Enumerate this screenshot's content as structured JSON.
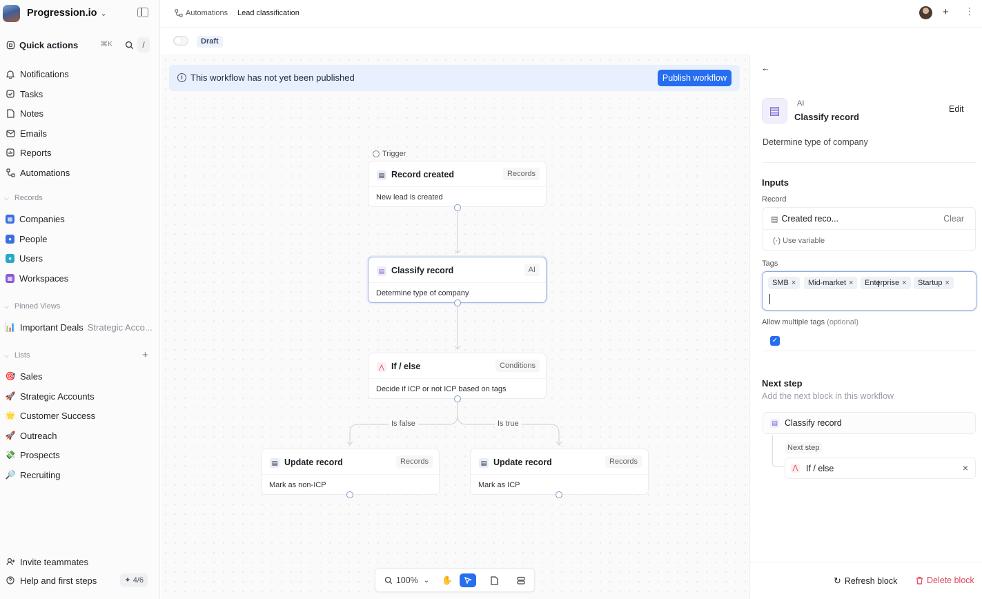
{
  "workspace": {
    "name": "Progression.io"
  },
  "sidebar": {
    "quick_actions": {
      "label": "Quick actions",
      "shortcut": "⌘K",
      "slash": "/"
    },
    "nav": [
      {
        "label": "Notifications",
        "icon": "bell-icon"
      },
      {
        "label": "Tasks",
        "icon": "check-square-icon"
      },
      {
        "label": "Notes",
        "icon": "note-icon"
      },
      {
        "label": "Emails",
        "icon": "mail-icon"
      },
      {
        "label": "Reports",
        "icon": "report-icon"
      },
      {
        "label": "Automations",
        "icon": "automation-icon"
      }
    ],
    "records_heading": "Records",
    "records": [
      {
        "label": "Companies",
        "color": "#3b6fe0"
      },
      {
        "label": "People",
        "color": "#3b6fe0"
      },
      {
        "label": "Users",
        "color": "#27a9c7"
      },
      {
        "label": "Workspaces",
        "color": "#8d5ad8"
      }
    ],
    "pinned_heading": "Pinned Views",
    "pinned": [
      {
        "label": "Important Deals",
        "sub": "Strategic Acco..."
      }
    ],
    "lists_heading": "Lists",
    "lists": [
      {
        "label": "Sales",
        "emoji": "🎯"
      },
      {
        "label": "Strategic Accounts",
        "emoji": "🚀"
      },
      {
        "label": "Customer Success",
        "emoji": "🌟"
      },
      {
        "label": "Outreach",
        "emoji": "🚀"
      },
      {
        "label": "Prospects",
        "emoji": "💸"
      },
      {
        "label": "Recruiting",
        "emoji": "🔎"
      }
    ],
    "invite": "Invite teammates",
    "help": "Help and first steps",
    "help_progress": "4/6"
  },
  "topbar": {
    "breadcrumb_parent": "Automations",
    "breadcrumb_current": "Lead classification"
  },
  "subbar": {
    "status": "Draft"
  },
  "banner": {
    "message": "This workflow has not yet been published",
    "publish_label": "Publish workflow"
  },
  "workflow": {
    "trigger_label": "Trigger",
    "nodes": {
      "trigger": {
        "title": "Record created",
        "tag": "Records",
        "desc": "New lead is created"
      },
      "classify": {
        "title": "Classify record",
        "tag": "AI",
        "desc": "Determine type of company"
      },
      "ifelse": {
        "title": "If / else",
        "tag": "Conditions",
        "desc": "Decide if ICP or not ICP based on tags"
      },
      "update_false": {
        "title": "Update record",
        "tag": "Records",
        "desc": "Mark as non-ICP"
      },
      "update_true": {
        "title": "Update record",
        "tag": "Records",
        "desc": "Mark as ICP"
      }
    },
    "branches": {
      "false_label": "Is false",
      "true_label": "Is true"
    }
  },
  "zoom": {
    "level": "100%"
  },
  "panel": {
    "category": "AI",
    "title": "Classify record",
    "edit_label": "Edit",
    "description": "Determine type of company",
    "inputs_heading": "Inputs",
    "record_label": "Record",
    "record_value": "Created reco...",
    "clear_label": "Clear",
    "use_variable": "Use variable",
    "tags_label": "Tags",
    "tags": [
      "SMB",
      "Mid-market",
      "Enterprise",
      "Startup"
    ],
    "allow_multiple_label": "Allow multiple tags",
    "allow_multiple_optional": "(optional)",
    "allow_multiple_checked": true,
    "next_step_heading": "Next step",
    "next_step_hint": "Add the next block in this workflow",
    "next_block": "Classify record",
    "nested_next_label": "Next step",
    "nested_next_block": "If / else",
    "refresh_label": "Refresh block",
    "delete_label": "Delete block"
  }
}
